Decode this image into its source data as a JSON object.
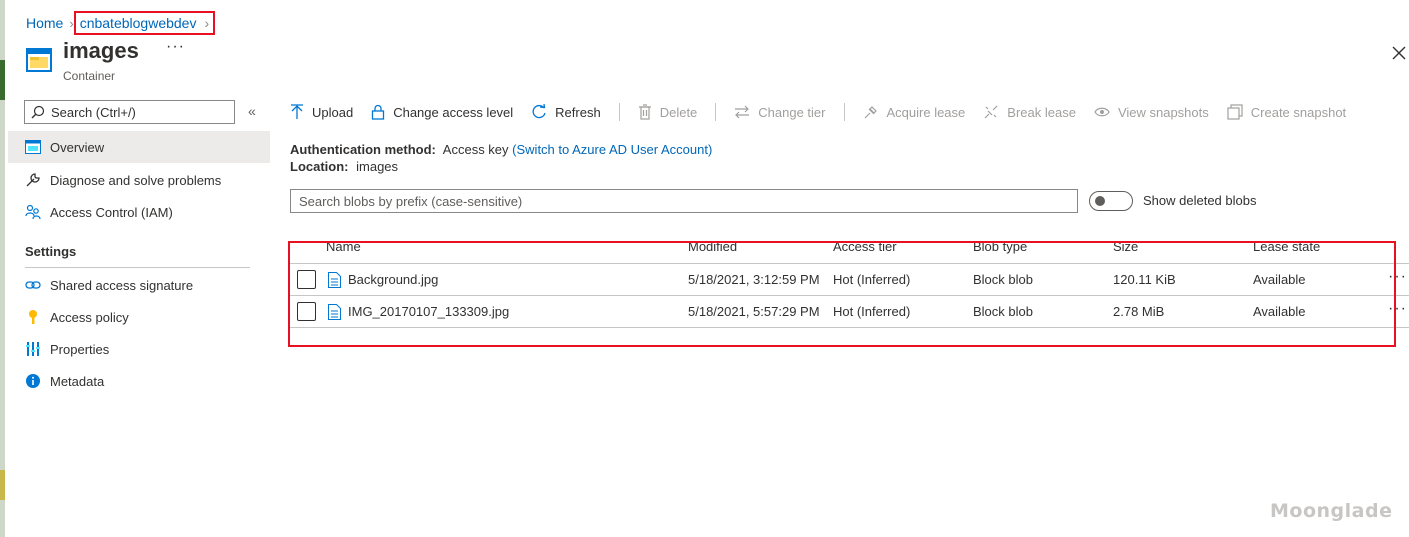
{
  "breadcrumb": {
    "home": "Home",
    "current": "cnbateblogwebdev"
  },
  "page": {
    "title": "images",
    "subtitle": "Container",
    "more": "···"
  },
  "sidebar": {
    "search_placeholder": "Search (Ctrl+/)",
    "collapse": "«",
    "items": [
      {
        "label": "Overview",
        "icon": "container-overview-icon",
        "active": true
      },
      {
        "label": "Diagnose and solve problems",
        "icon": "wrench-icon"
      },
      {
        "label": "Access Control (IAM)",
        "icon": "people-icon"
      }
    ],
    "settings_header": "Settings",
    "settings_items": [
      {
        "label": "Shared access signature",
        "icon": "link-icon"
      },
      {
        "label": "Access policy",
        "icon": "key-icon"
      },
      {
        "label": "Properties",
        "icon": "properties-icon"
      },
      {
        "label": "Metadata",
        "icon": "info-icon"
      }
    ]
  },
  "toolbar": {
    "upload": "Upload",
    "change_access_level": "Change access level",
    "refresh": "Refresh",
    "delete": "Delete",
    "change_tier": "Change tier",
    "acquire_lease": "Acquire lease",
    "break_lease": "Break lease",
    "view_snapshots": "View snapshots",
    "create_snapshot": "Create snapshot"
  },
  "auth": {
    "method_label": "Authentication method:",
    "method_value": "Access key",
    "switch_link": "(Switch to Azure AD User Account)",
    "location_label": "Location:",
    "location_value": "images"
  },
  "filter": {
    "placeholder": "Search blobs by prefix (case-sensitive)",
    "toggle_label": "Show deleted blobs"
  },
  "table": {
    "columns": [
      "Name",
      "Modified",
      "Access tier",
      "Blob type",
      "Size",
      "Lease state"
    ],
    "rows": [
      {
        "name": "Background.jpg",
        "modified": "5/18/2021, 3:12:59 PM",
        "tier": "Hot (Inferred)",
        "type": "Block blob",
        "size": "120.11 KiB",
        "lease": "Available",
        "more": "···"
      },
      {
        "name": "IMG_20170107_133309.jpg",
        "modified": "5/18/2021, 5:57:29 PM",
        "tier": "Hot (Inferred)",
        "type": "Block blob",
        "size": "2.78 MiB",
        "lease": "Available",
        "more": "···"
      }
    ]
  },
  "watermark": "Moonglade",
  "colors": {
    "link": "#0067b8",
    "highlight": "#e81123",
    "active_nav": "#edebe9"
  }
}
